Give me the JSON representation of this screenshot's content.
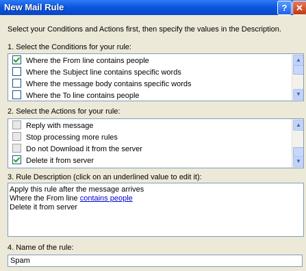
{
  "window": {
    "title": "New Mail Rule",
    "help_label": "?",
    "close_label": "✕"
  },
  "instructions": "Select your Conditions and Actions first, then specify the values in the Description.",
  "conditions": {
    "heading": "1. Select the Conditions for your rule:",
    "items": [
      {
        "label": "Where the From line contains people",
        "checked": true
      },
      {
        "label": "Where the Subject line contains specific words",
        "checked": false
      },
      {
        "label": "Where the message body contains specific words",
        "checked": false
      },
      {
        "label": "Where the To line contains people",
        "checked": false
      }
    ]
  },
  "actions": {
    "heading": "2. Select the Actions for your rule:",
    "items": [
      {
        "label": "Reply with message",
        "checked": false
      },
      {
        "label": "Stop processing more rules",
        "checked": false
      },
      {
        "label": "Do not Download it from the server",
        "checked": false
      },
      {
        "label": "Delete it from server",
        "checked": true
      }
    ]
  },
  "description": {
    "heading": "3. Rule Description (click on an underlined value to edit it):",
    "line1": "Apply this rule after the message arrives",
    "line2_prefix": "Where the From line ",
    "line2_link": "contains people",
    "line3": "Delete it from server"
  },
  "rule_name": {
    "heading": "4. Name of the rule:",
    "value": "Spam"
  }
}
